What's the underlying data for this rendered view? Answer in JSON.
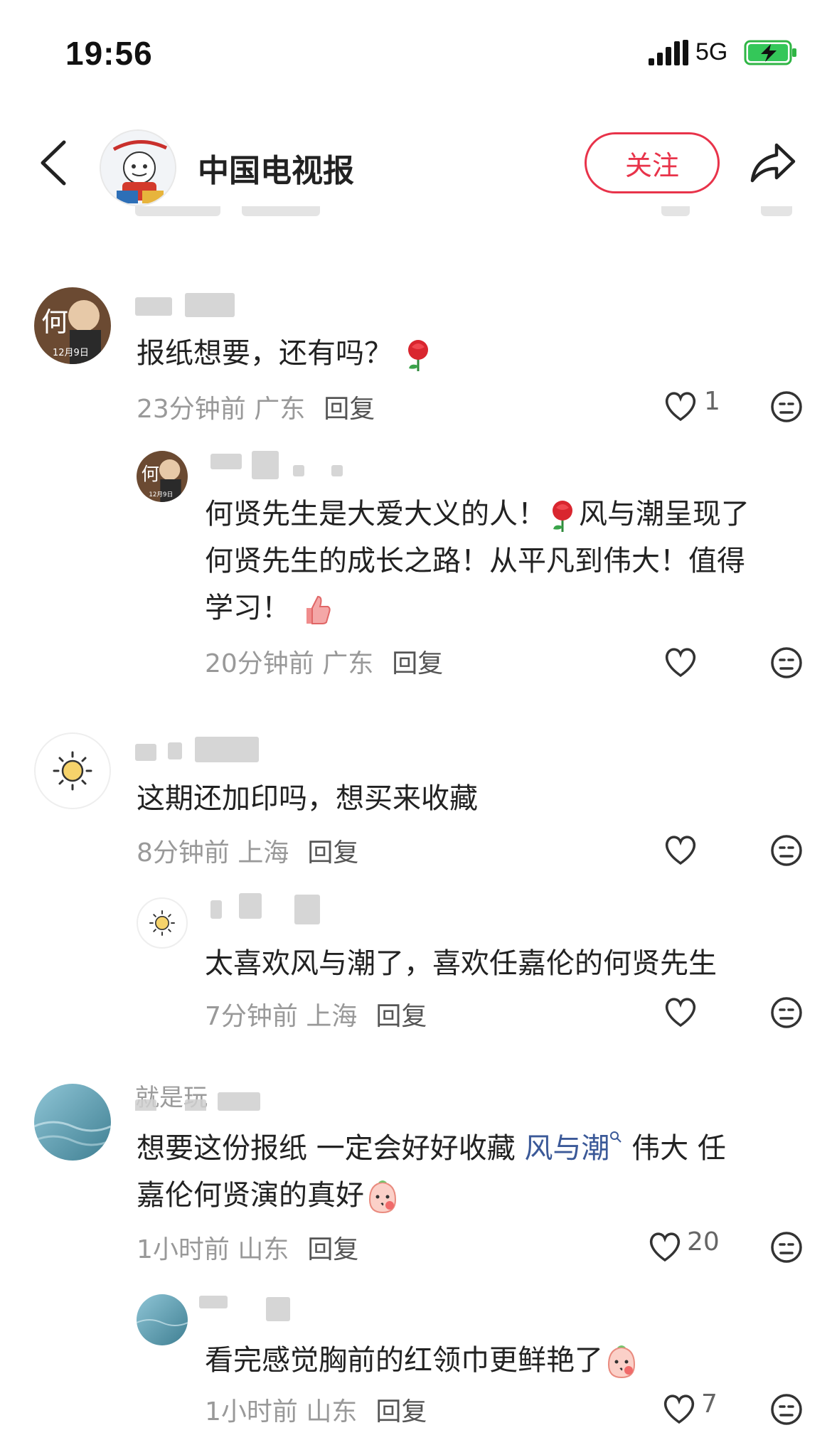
{
  "status_bar": {
    "time": "19:56",
    "network": "5G"
  },
  "header": {
    "back_icon": "chevron-left-icon",
    "account_name": "中国电视报",
    "follow_label": "关注",
    "share_icon": "share-arrow-icon"
  },
  "comments": [
    {
      "text": "报纸想要，还有吗？",
      "time": "23分钟前",
      "location": "广东",
      "reply_label": "回复",
      "likes": "1",
      "replies": [
        {
          "text_line1": "何贤先生是大爱大义的人！",
          "text_line1b": "风与潮呈现了",
          "text_line2": "何贤先生的成长之路！从平凡到伟大！值得",
          "text_line3": "学习！",
          "time": "20分钟前",
          "location": "广东",
          "reply_label": "回复"
        }
      ]
    },
    {
      "text": "这期还加印吗，想买来收藏",
      "time": "8分钟前",
      "location": "上海",
      "reply_label": "回复",
      "replies": [
        {
          "text": "太喜欢风与潮了，喜欢任嘉伦的何贤先生",
          "time": "7分钟前",
          "location": "上海",
          "reply_label": "回复"
        }
      ]
    },
    {
      "username_partial": "就是玩",
      "text_line1_a": "想要这份报纸 一定会好好收藏",
      "topic": "风与潮",
      "text_line1_b": "伟大 任",
      "text_line2": "嘉伦何贤演的真好",
      "time": "1小时前",
      "location": "山东",
      "reply_label": "回复",
      "likes": "20",
      "replies": [
        {
          "text": "看完感觉胸前的红领巾更鲜艳了",
          "time": "1小时前",
          "location": "山东",
          "reply_label": "回复",
          "likes": "7"
        }
      ]
    }
  ],
  "avatar_caption": {
    "big_char": "何",
    "date": "12月9日"
  },
  "colors": {
    "follow": "#e8334a",
    "topic": "#3b5998",
    "muted": "#999999"
  }
}
